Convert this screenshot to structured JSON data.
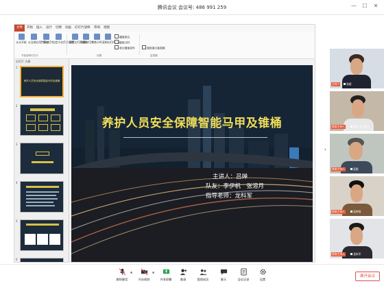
{
  "window": {
    "title": "腾讯会议  会议号: 486 991 259"
  },
  "ppt": {
    "ribbon_tabs": [
      "文件",
      "开始",
      "插入",
      "设计",
      "切换",
      "动画",
      "幻灯片放映",
      "审阅",
      "视图"
    ],
    "ribbon_groups": [
      "开始放映幻灯片",
      "设置",
      "监视器"
    ],
    "ribbon_buttons": [
      "从头开始",
      "从当前幻灯片开始",
      "广播幻灯片",
      "自定义幻灯片放映",
      "设置幻灯片放映",
      "隐藏幻灯片",
      "排练计时",
      "录制幻灯片演示"
    ],
    "ribbon_checks": [
      "播放旁白",
      "使用计时",
      "显示媒体控件",
      "使用演示者视图"
    ],
    "thumbs_header": "幻灯片 大纲",
    "thumbnails": [
      {
        "num": "1",
        "text": "养护人员安全保障智能马甲及锥桶"
      },
      {
        "num": "2",
        "text": ""
      },
      {
        "num": "3",
        "text": ""
      },
      {
        "num": "4",
        "text": ""
      },
      {
        "num": "5",
        "text": ""
      },
      {
        "num": "6",
        "text": ""
      }
    ],
    "slide": {
      "title": "养护人员安全保障智能马甲及锥桶",
      "speaker": "主讲人：吕婵",
      "team": "队友：李伊帆　张溶月",
      "advisor": "指导老师：龙科军"
    }
  },
  "videos": [
    {
      "tag": "主持人",
      "name": "张斌"
    },
    {
      "tag": "联席主持人",
      "name": "周杰-长沙理工"
    },
    {
      "tag": "联席主持人",
      "name": "吴晗"
    },
    {
      "tag": "联席主持人",
      "name": "吴梓铭"
    },
    {
      "tag": "联席主持人",
      "name": "龙科军"
    }
  ],
  "toolbar": {
    "items": [
      "解除静音",
      "开启视频",
      "共享屏幕",
      "邀请",
      "管理成员",
      "聊天",
      "会议记录",
      "设置"
    ],
    "end": "离开会议"
  },
  "colors": {
    "accent_red": "#e34b4b",
    "slide_title": "#f0de5a",
    "selected_border": "#f2b33a"
  }
}
